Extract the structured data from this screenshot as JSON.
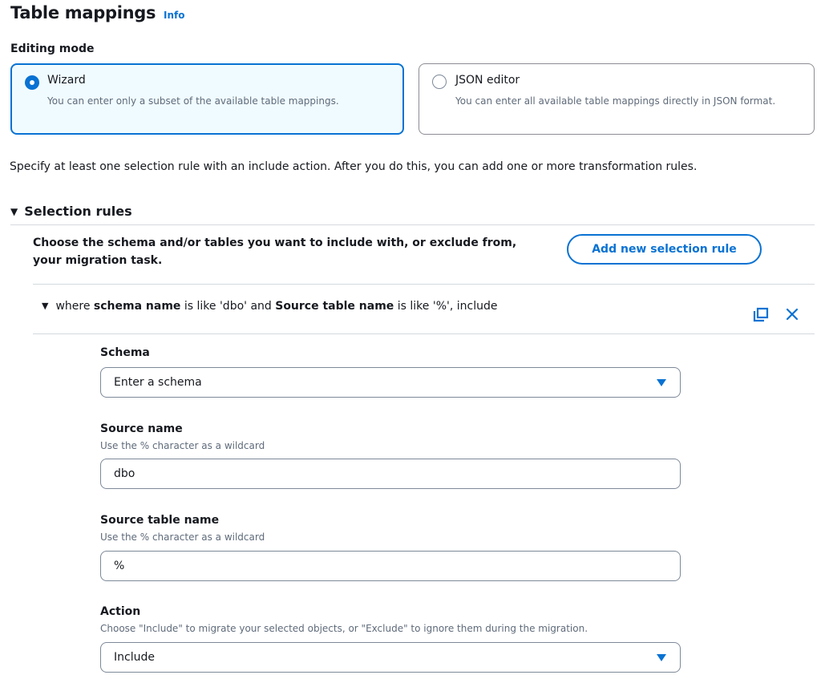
{
  "header": {
    "title": "Table mappings",
    "info_label": "Info"
  },
  "editing_mode": {
    "label": "Editing mode",
    "options": [
      {
        "title": "Wizard",
        "description": "You can enter only a subset of the available table mappings.",
        "selected": true
      },
      {
        "title": "JSON editor",
        "description": "You can enter all available table mappings directly in JSON format.",
        "selected": false
      }
    ]
  },
  "help_text": "Specify at least one selection rule with an include action. After you do this, you can add one or more transformation rules.",
  "selection_rules": {
    "title": "Selection rules",
    "description": "Choose the schema and/or tables you want to include with, or exclude from, your migration task.",
    "add_button_label": "Add new selection rule",
    "rule": {
      "summary_parts": [
        "where ",
        "schema name",
        " is like 'dbo' and ",
        "Source table name",
        " is like '%', include"
      ],
      "copy_icon": "copy-icon",
      "remove_icon": "close-icon",
      "schema": {
        "label": "Schema",
        "placeholder": "Enter a schema"
      },
      "source_name": {
        "label": "Source name",
        "description": "Use the % character as a wildcard",
        "value": "dbo"
      },
      "source_table_name": {
        "label": "Source table name",
        "description": "Use the % character as a wildcard",
        "value": "%"
      },
      "action": {
        "label": "Action",
        "description": "Choose \"Include\" to migrate your selected objects, or \"Exclude\" to ignore them during the migration.",
        "value": "Include"
      }
    }
  },
  "colors": {
    "accent": "#0972d3",
    "text": "#16191f",
    "muted": "#5f6b7a",
    "border": "#7d8998",
    "selected_bg": "#f0fbff"
  }
}
